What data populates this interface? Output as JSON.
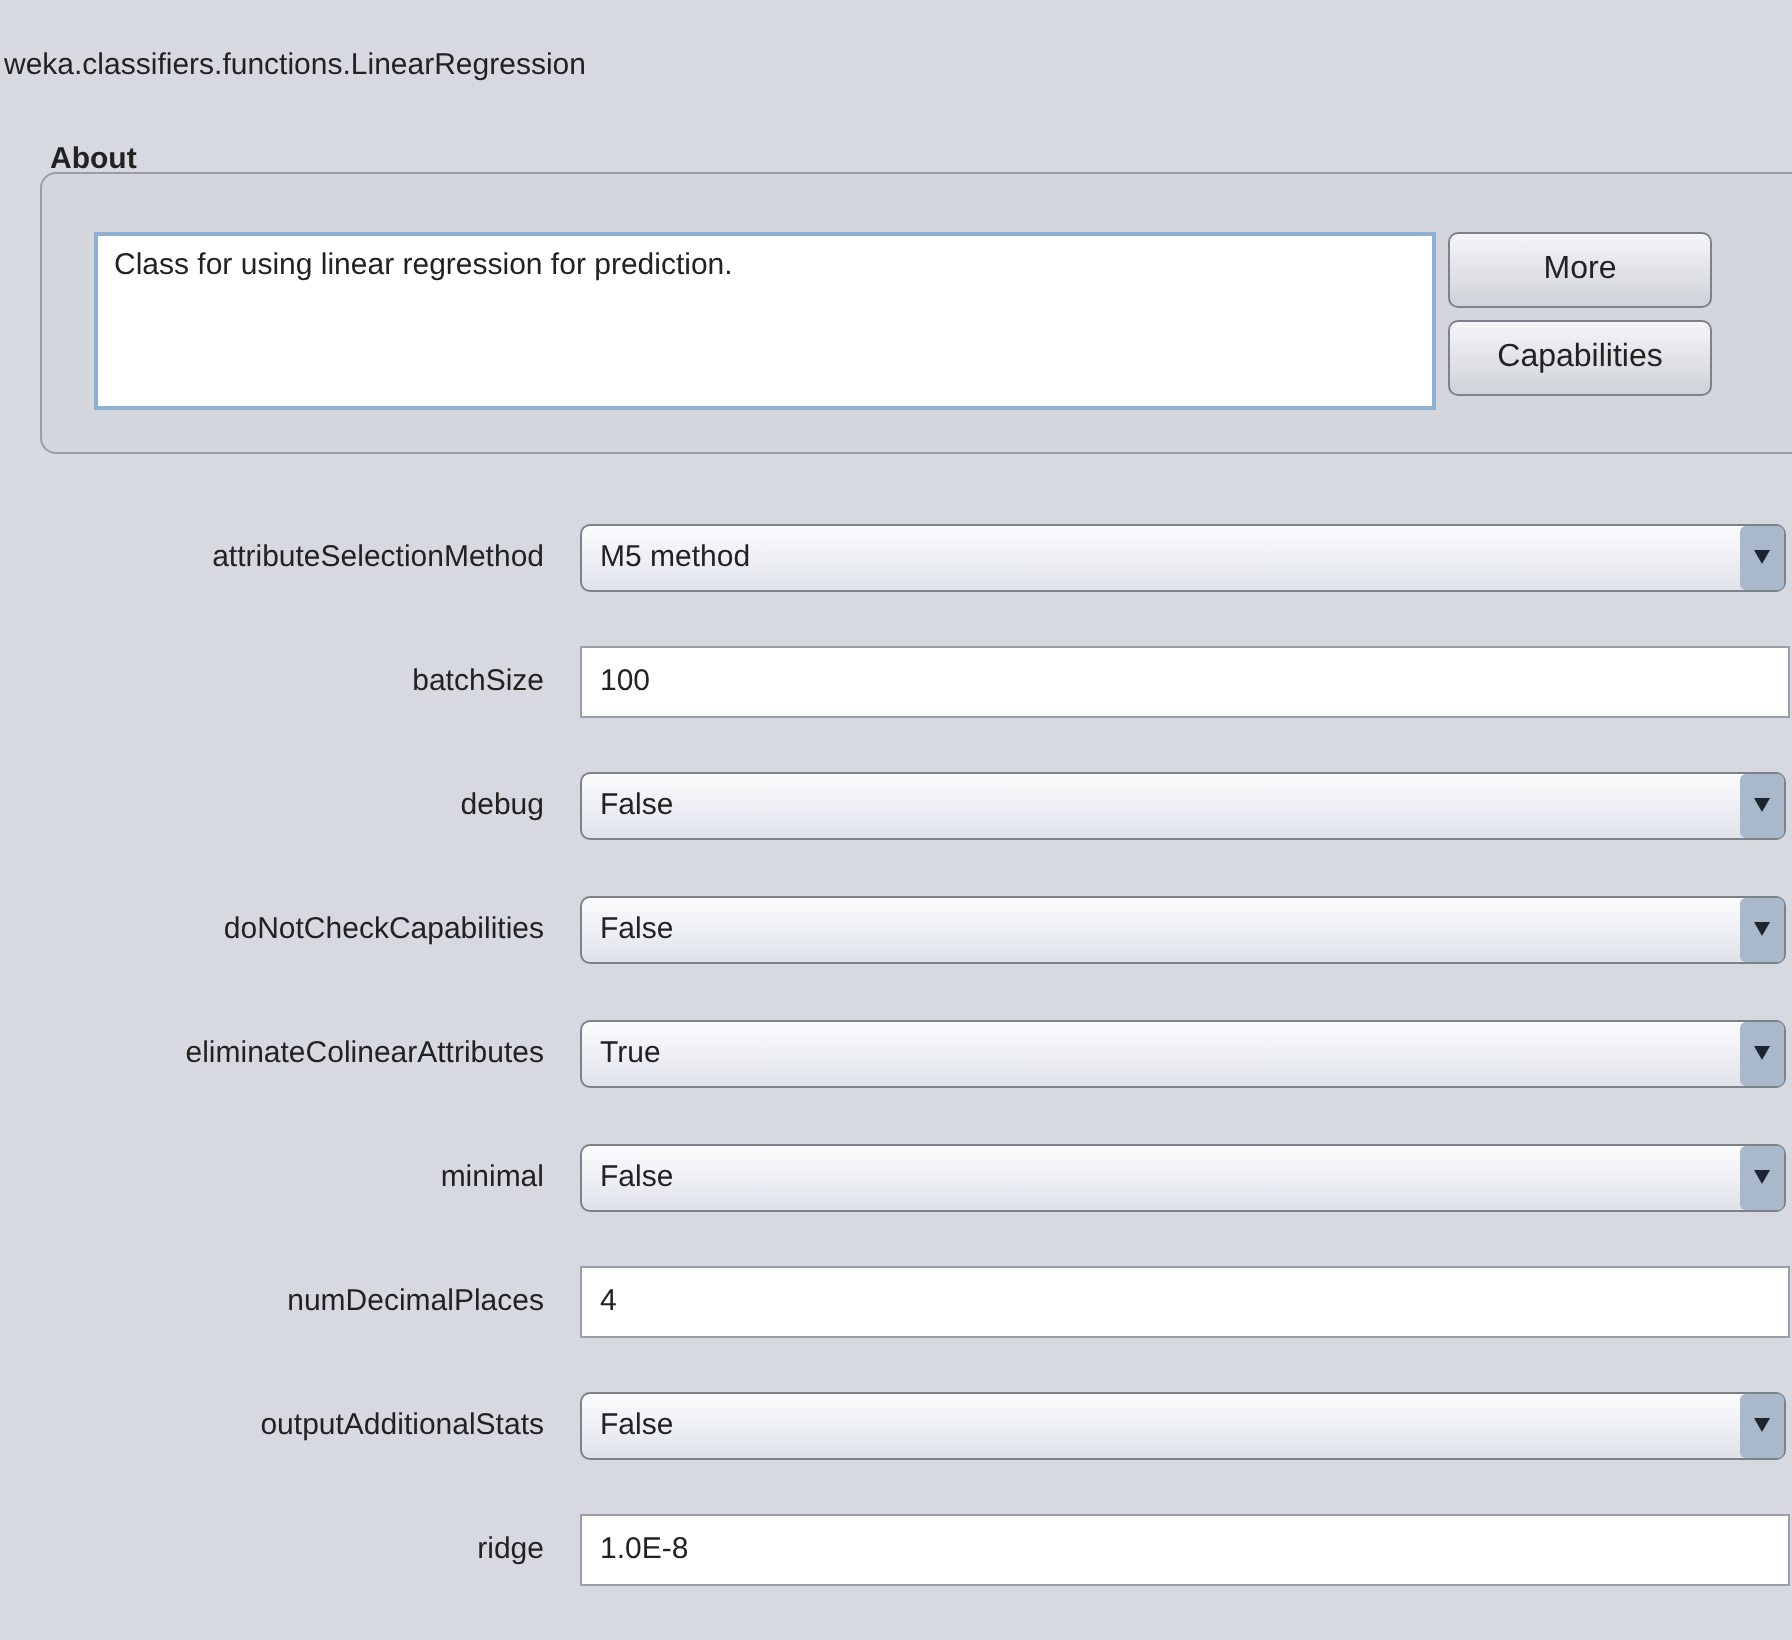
{
  "window": {
    "title": "weka.classifiers.functions.LinearRegression"
  },
  "about": {
    "heading": "About",
    "text": "Class for using linear regression for prediction.",
    "buttons": [
      "More",
      "Capabilities"
    ]
  },
  "properties": [
    {
      "label": "attributeSelectionMethod",
      "kind": "dropdown",
      "value": "M5 method"
    },
    {
      "label": "batchSize",
      "kind": "text",
      "value": "100"
    },
    {
      "label": "debug",
      "kind": "dropdown",
      "value": "False"
    },
    {
      "label": "doNotCheckCapabilities",
      "kind": "dropdown",
      "value": "False"
    },
    {
      "label": "eliminateColinearAttributes",
      "kind": "dropdown",
      "value": "True"
    },
    {
      "label": "minimal",
      "kind": "dropdown",
      "value": "False"
    },
    {
      "label": "numDecimalPlaces",
      "kind": "text",
      "value": "4"
    },
    {
      "label": "outputAdditionalStats",
      "kind": "dropdown",
      "value": "False"
    },
    {
      "label": "ridge",
      "kind": "text",
      "value": "1.0E-8"
    }
  ]
}
